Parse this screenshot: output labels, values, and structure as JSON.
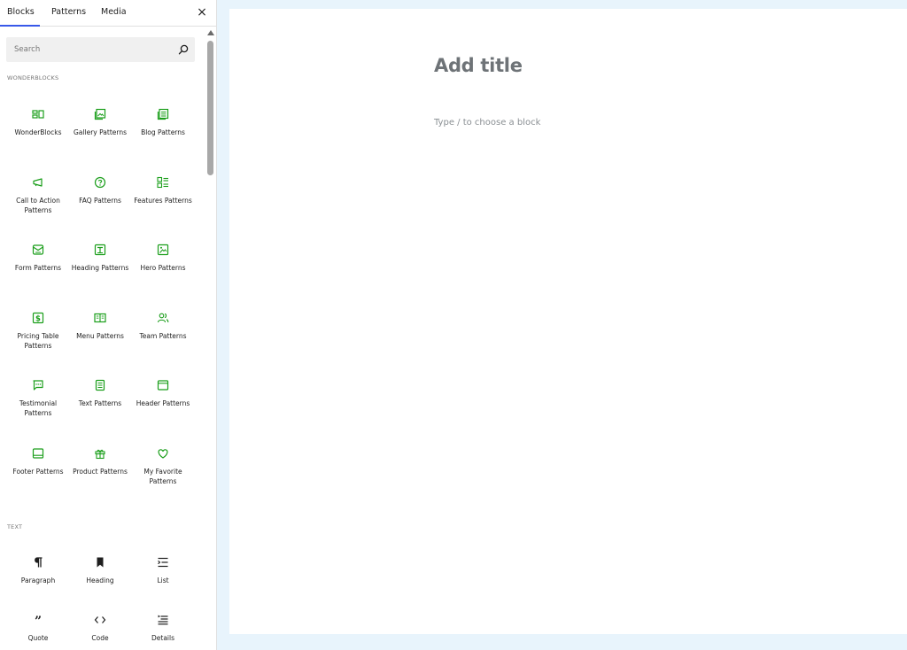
{
  "inserter": {
    "tabs": [
      {
        "label": "Blocks",
        "active": true
      },
      {
        "label": "Patterns",
        "active": false
      },
      {
        "label": "Media",
        "active": false
      }
    ],
    "close_label": "×",
    "search": {
      "placeholder": "Search",
      "value": ""
    },
    "accent_color": "#1a9e1a",
    "sections": [
      {
        "title": "WONDERBLOCKS",
        "items": [
          {
            "label": "WonderBlocks",
            "icon": "wonderblocks-icon"
          },
          {
            "label": "Gallery Patterns",
            "icon": "gallery-icon"
          },
          {
            "label": "Blog Patterns",
            "icon": "blog-icon"
          },
          {
            "label": "Call to Action Patterns",
            "icon": "megaphone-icon"
          },
          {
            "label": "FAQ Patterns",
            "icon": "question-icon"
          },
          {
            "label": "Features Patterns",
            "icon": "features-icon"
          },
          {
            "label": "Form Patterns",
            "icon": "form-icon"
          },
          {
            "label": "Heading Patterns",
            "icon": "heading-pattern-icon"
          },
          {
            "label": "Hero Patterns",
            "icon": "hero-icon"
          },
          {
            "label": "Pricing Table Patterns",
            "icon": "pricing-icon"
          },
          {
            "label": "Menu Patterns",
            "icon": "menu-icon"
          },
          {
            "label": "Team Patterns",
            "icon": "team-icon"
          },
          {
            "label": "Testimonial Patterns",
            "icon": "testimonial-icon"
          },
          {
            "label": "Text Patterns",
            "icon": "text-pattern-icon"
          },
          {
            "label": "Header Patterns",
            "icon": "header-icon"
          },
          {
            "label": "Footer Patterns",
            "icon": "footer-icon"
          },
          {
            "label": "Product Patterns",
            "icon": "gift-icon"
          },
          {
            "label": "My Favorite Patterns",
            "icon": "heart-icon"
          }
        ]
      },
      {
        "title": "TEXT",
        "items": [
          {
            "label": "Paragraph",
            "icon": "paragraph-icon"
          },
          {
            "label": "Heading",
            "icon": "bookmark-icon"
          },
          {
            "label": "List",
            "icon": "list-icon"
          },
          {
            "label": "Quote",
            "icon": "quote-icon"
          },
          {
            "label": "Code",
            "icon": "code-icon"
          },
          {
            "label": "Details",
            "icon": "details-icon"
          }
        ]
      }
    ]
  },
  "editor": {
    "title_placeholder": "Add title",
    "block_placeholder": "Type / to choose a block"
  }
}
